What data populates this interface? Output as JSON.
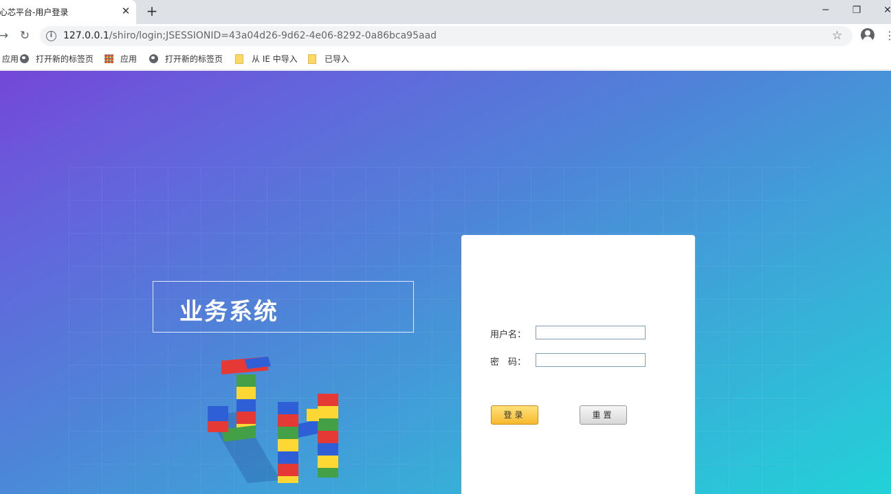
{
  "browser": {
    "tab_title": "星心芯平台-用户登录",
    "tab_close": "✕",
    "new_tab": "+",
    "minimize": "─",
    "restore": "❐",
    "close": "✕",
    "url_host": "127.0.0.1",
    "url_path": "/shiro/login;JSESSIONID=43a04d26-9d62-4e06-8292-0a86bca95aad",
    "back": "←",
    "forward": "→",
    "reload": "↻",
    "star": "☆",
    "menu": "⋮",
    "info": "i"
  },
  "bookmarks": [
    {
      "label": "应用",
      "icon": "apps-grid-icon"
    },
    {
      "label": "打开新的标签页",
      "icon": "globe-icon"
    },
    {
      "label": "应用",
      "icon": "apps-grid-icon"
    },
    {
      "label": "打开新的标签页",
      "icon": "globe-icon"
    },
    {
      "label": "从 IE 中导入",
      "icon": "folder-icon"
    },
    {
      "label": "已导入",
      "icon": "folder-icon"
    }
  ],
  "page": {
    "brand_title": "业务系统"
  },
  "login": {
    "username_label": "用户名：",
    "username_value": "",
    "password_label": "密　码：",
    "password_value": "",
    "login_button": "登录",
    "reset_button": "重置"
  },
  "colors": {
    "gradient_start": "#7447d8",
    "gradient_end": "#22d2d8",
    "login_button": "#f7b92e"
  }
}
